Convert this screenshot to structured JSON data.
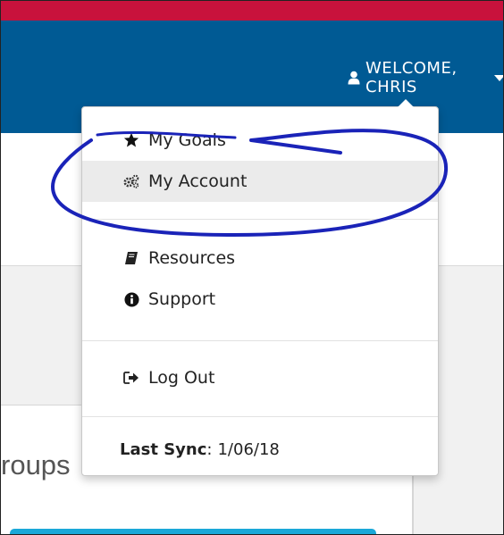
{
  "header": {
    "welcome_text": "WELCOME, CHRIS"
  },
  "menu": {
    "items": [
      {
        "label": "My Goals",
        "icon": "star-icon"
      },
      {
        "label": "My Account",
        "icon": "gears-icon"
      },
      {
        "label": "Resources",
        "icon": "book-icon"
      },
      {
        "label": "Support",
        "icon": "info-icon"
      },
      {
        "label": "Log Out",
        "icon": "sign-out-icon"
      }
    ],
    "last_sync_label": "Last Sync",
    "last_sync_value": "1/06/18"
  },
  "background": {
    "groups_text_fragment": "roups"
  },
  "colors": {
    "top_stripe": "#c8123c",
    "navbar": "#005a94",
    "annotation": "#1a23b8",
    "active_item": "#ebebeb"
  }
}
